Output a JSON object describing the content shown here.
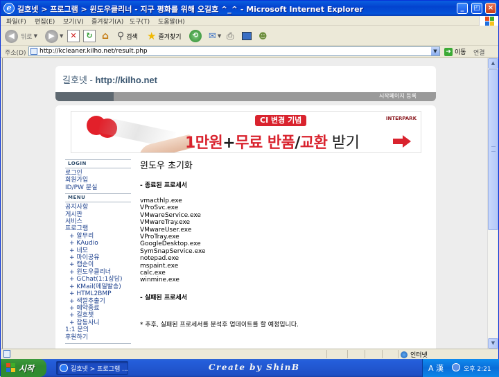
{
  "window": {
    "title": "길호넷 > 프로그램 > 윈도우클리너 - 지구 평화를 위해 오길호 ^_^ - Microsoft Internet Explorer",
    "min": "_",
    "max": "□",
    "restore": "◰",
    "close": "×"
  },
  "menu": [
    "파일(F)",
    "편집(E)",
    "보기(V)",
    "즐겨찾기(A)",
    "도구(T)",
    "도움말(H)"
  ],
  "toolbar": {
    "back_label": "뒤로",
    "search_label": "검색",
    "favorites_label": "즐겨찾기"
  },
  "address": {
    "label": "주소(D)",
    "url": "http://kcleaner.kilho.net/result.php",
    "go_label": "이동",
    "links_label": "연결"
  },
  "site": {
    "name_prefix": "길호넷 - ",
    "name_url": "http://kilho.net",
    "header_link": "시작페이지 등록"
  },
  "banner": {
    "badge": "CI 변경 기념",
    "brand": "INTERPARK",
    "promo_a": "1만원",
    "promo_plus": "+",
    "promo_b": "무료 반품",
    "promo_slash": "/",
    "promo_c": "교환",
    "promo_d": " 받기"
  },
  "sidebar": {
    "login_head": "LOGIN",
    "login_items": [
      "로그인",
      "회원가입",
      "ID/PW 분실"
    ],
    "menu_head": "MENU",
    "menu_items": [
      "공지사항",
      "게시판",
      "서비스",
      "프로그램"
    ],
    "program_items": [
      "알무리",
      "KAudio",
      "네모",
      "마이공유",
      "캡순이",
      "윈도우클리너",
      "GChat(1:1상담)",
      "KMail(메일발송)",
      "HTML2BMP",
      "색깔추출기",
      "예약종료",
      "길호챗",
      "잡동사니"
    ],
    "bottom_items": [
      "1:1 문의",
      "후원하기"
    ]
  },
  "content": {
    "title": "윈도우 초기화",
    "terminated_head": "- 종료된 프로세서",
    "processes": [
      "vmacthlp.exe",
      "VProSvc.exe",
      "VMwareService.exe",
      "VMwareTray.exe",
      "VMwareUser.exe",
      "VProTray.exe",
      "GoogleDesktop.exe",
      "SymSnapService.exe",
      "notepad.exe",
      "mspaint.exe",
      "calc.exe",
      "winmine.exe"
    ],
    "failed_head": "- 실패된 프로세서",
    "note": "* 추후, 실패된 프로세서를 분석후 업데이트를 할 예정입니다."
  },
  "status": {
    "zone": "인터넷"
  },
  "taskbar": {
    "start": "시작",
    "task": "길호넷 > 프로그램 ...",
    "signature": "Create by ShinB",
    "ime": "A 漢",
    "time": "오후 2:21"
  }
}
